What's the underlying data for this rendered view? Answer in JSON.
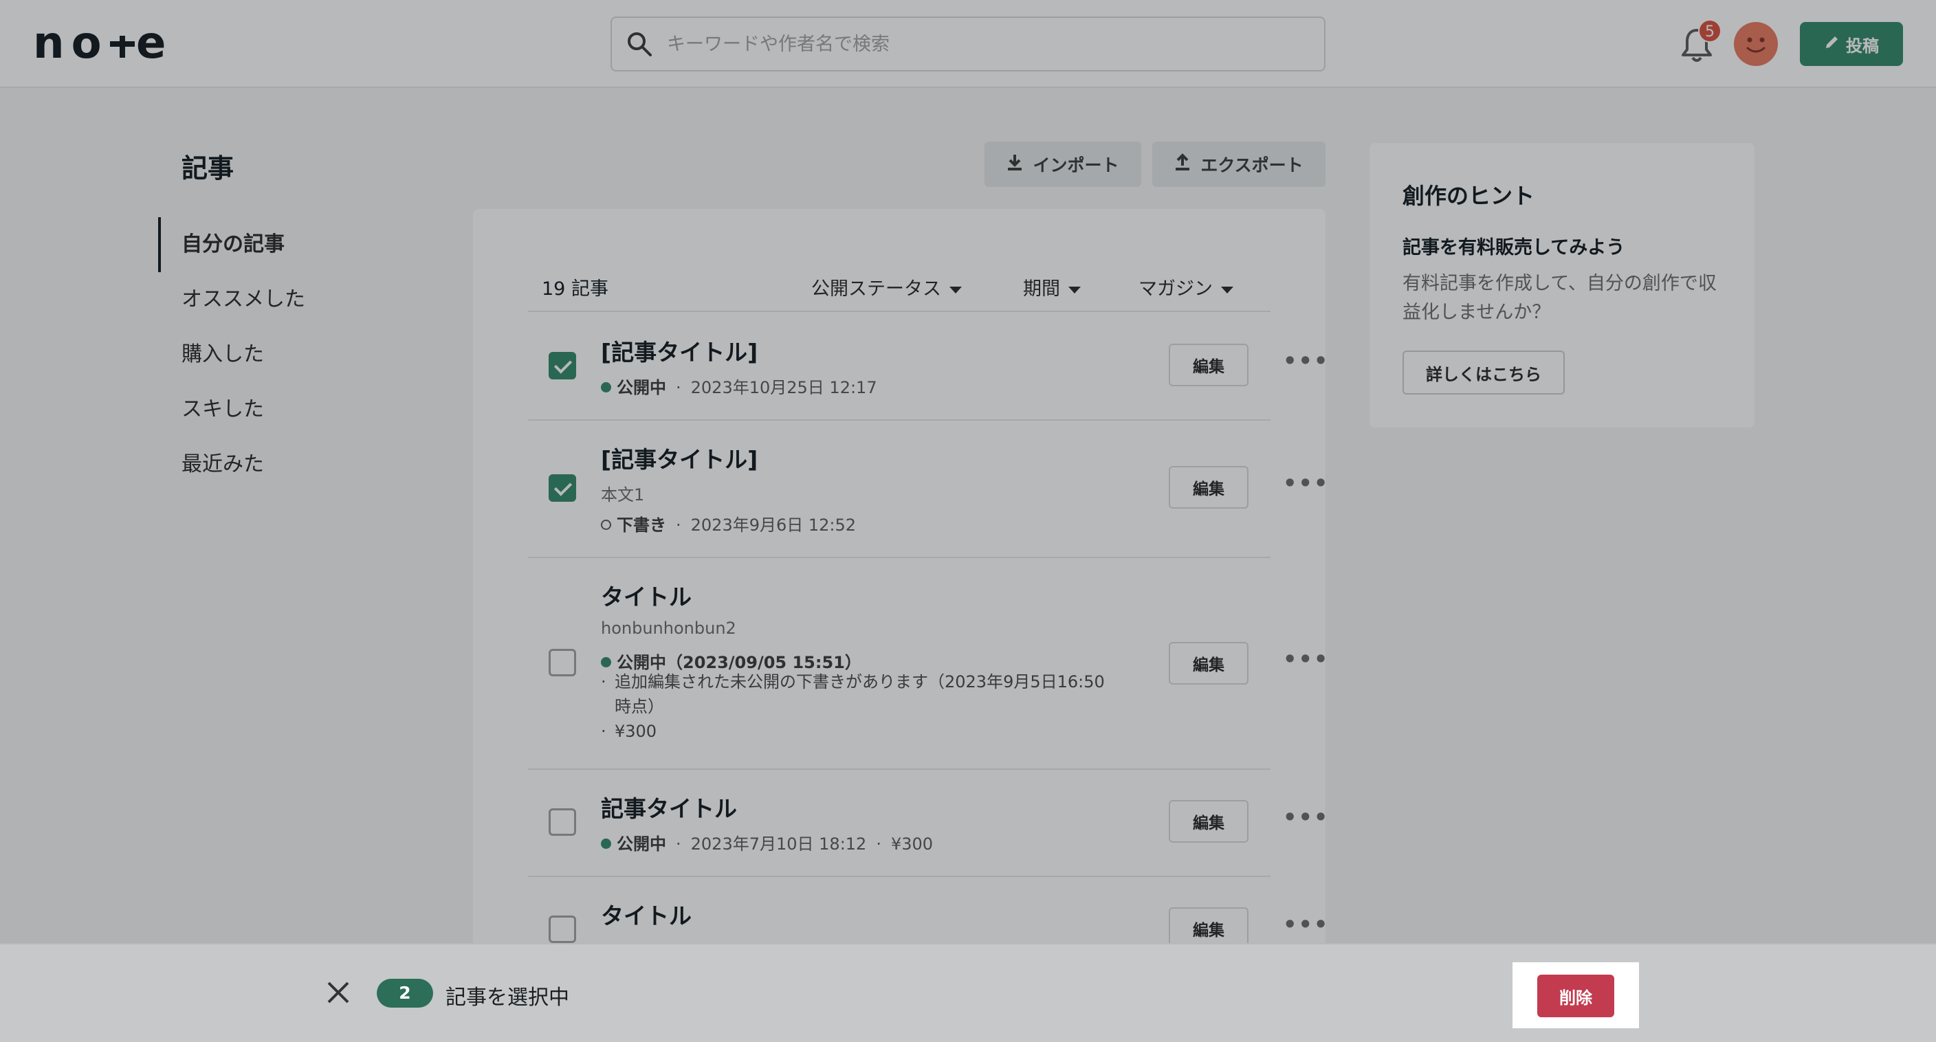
{
  "header": {
    "logo": "note",
    "search_placeholder": "キーワードや作者名で検索",
    "notification_count": "5",
    "post_label": "投稿"
  },
  "page": {
    "title": "記事",
    "import_label": "インポート",
    "export_label": "エクスポート"
  },
  "sidebar": {
    "items": [
      {
        "label": "自分の記事",
        "active": true
      },
      {
        "label": "オススメした"
      },
      {
        "label": "購入した"
      },
      {
        "label": "スキした"
      },
      {
        "label": "最近みた"
      }
    ]
  },
  "list": {
    "count_label": "19 記事",
    "filters": [
      "公開ステータス",
      "期間",
      "マガジン"
    ],
    "edit_label": "編集",
    "more_label": "•••",
    "articles": [
      {
        "title": "[記事タイトル]",
        "checked": true,
        "status": "公開中",
        "date": "2023年10月25日 12:17"
      },
      {
        "title": "[記事タイトル]",
        "checked": true,
        "body": "本文1",
        "status": "下書き",
        "date": "2023年9月6日 12:52"
      },
      {
        "title": "タイトル",
        "checked": false,
        "body": "honbunhonbun2",
        "status": "公開中（2023/09/05 15:51）",
        "note": "追加編集された未公開の下書きがあります（2023年9月5日16:50時点）",
        "price": "¥300"
      },
      {
        "title": "記事タイトル",
        "checked": false,
        "status": "公開中",
        "date": "2023年7月10日 18:12",
        "price": "¥300"
      },
      {
        "title": "タイトル",
        "checked": false
      }
    ]
  },
  "hint": {
    "title": "創作のヒント",
    "subtitle": "記事を有料販売してみよう",
    "body": "有料記事を作成して、自分の創作で収益化しませんか？",
    "button_label": "詳しくはこちら"
  },
  "selection_bar": {
    "count": "2",
    "text": "記事を選択中",
    "delete_label": "削除"
  },
  "colors": {
    "brand_green": "#2c8566",
    "delete_red": "#c23b4f",
    "badge_red": "#d94a38",
    "avatar": "#e8755c"
  }
}
